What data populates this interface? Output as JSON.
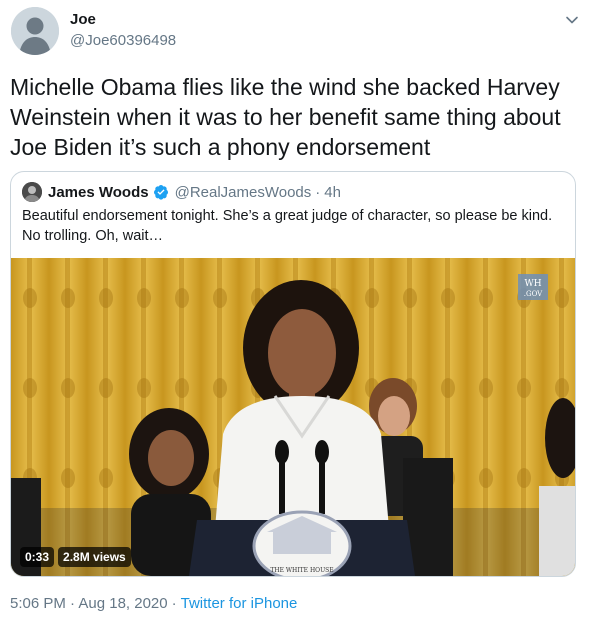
{
  "tweet": {
    "author_name": "Joe",
    "author_handle": "@Joe60396498",
    "text": "Michelle Obama flies like the wind she backed Harvey Weinstein when it was to her benefit same thing about Joe Biden it’s such a phony endorsement",
    "timestamp": "5:06 PM · Aug 18, 2020",
    "separator": "·",
    "source": "Twitter for iPhone"
  },
  "quoted_tweet": {
    "author_name": "James Woods",
    "author_handle": "@RealJamesWoods",
    "dot": "·",
    "time": "4h",
    "text": "Beautiful endorsement tonight. She’s a great judge of character, so please be kind. No trolling.  Oh, wait…",
    "verified": true,
    "media": {
      "duration": "0:33",
      "views": "2.8M views",
      "watermark_line1": "WH",
      "watermark_line2": ".GOV",
      "podium_text": "THE WHITE HOUSE"
    }
  },
  "colors": {
    "text": "#14171a",
    "secondary": "#657786",
    "link": "#1b95e0",
    "verified": "#1da1f2",
    "border": "#ccd6dd"
  },
  "icons": {
    "menu": "chevron-down-icon",
    "verified": "verified-badge-icon"
  }
}
